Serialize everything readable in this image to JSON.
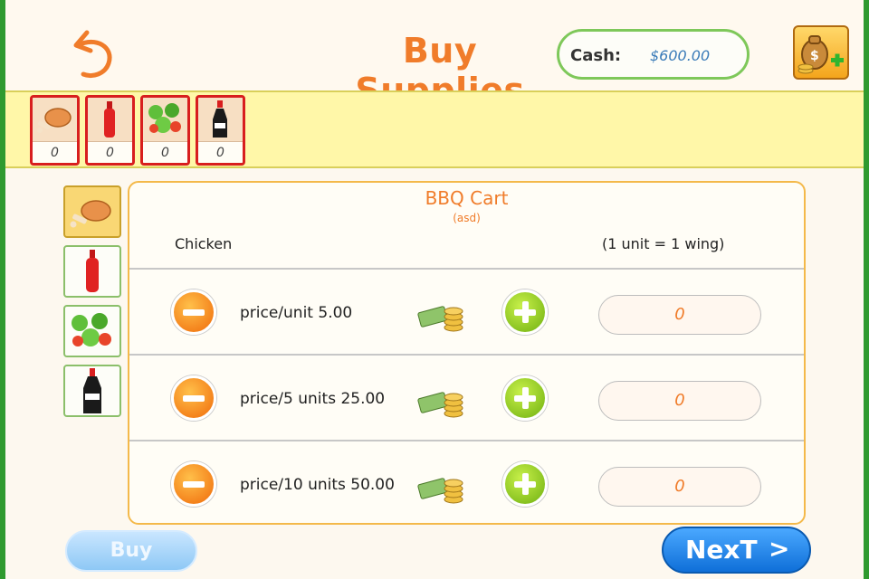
{
  "header": {
    "title": "Buy Supplies",
    "cash_label": "Cash:",
    "cash_value": "$600.00"
  },
  "inventory": [
    {
      "item": "chicken",
      "count": "0"
    },
    {
      "item": "sauce-bottle",
      "count": "0"
    },
    {
      "item": "salad",
      "count": "0"
    },
    {
      "item": "soy-sauce",
      "count": "0"
    }
  ],
  "tabs": [
    {
      "item": "chicken",
      "active": true
    },
    {
      "item": "sauce-bottle",
      "active": false
    },
    {
      "item": "salad",
      "active": false
    },
    {
      "item": "soy-sauce",
      "active": false
    }
  ],
  "panel": {
    "title": "BBQ Cart",
    "subtitle": "(asd)",
    "item_name": "Chicken",
    "unit_note": "(1 unit = 1 wing)",
    "rows": [
      {
        "price_label": "price/unit 5.00",
        "quantity": "0"
      },
      {
        "price_label": "price/5 units 25.00",
        "quantity": "0"
      },
      {
        "price_label": "price/10 units 50.00",
        "quantity": "0"
      }
    ]
  },
  "buttons": {
    "buy_label": "Buy",
    "next_label": "NexT",
    "next_chevron": ">"
  },
  "colors": {
    "accent_orange": "#f07c2a",
    "frame_green": "#2f9a2f",
    "inventory_bar": "#fff7a8",
    "panel_border": "#f4b94a",
    "next_blue": "#0f6fd8"
  }
}
